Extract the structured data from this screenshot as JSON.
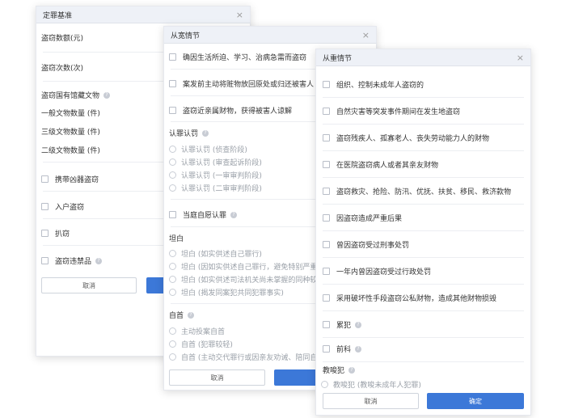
{
  "panel1": {
    "title": "定罪基准",
    "fields": [
      "盗窃数额(元)",
      "盗窃次数(次)"
    ],
    "cultural_relics": {
      "heading": "盗窃国有馆藏文物",
      "items": [
        "一般文物数量 (件)",
        "三级文物数量 (件)",
        "二级文物数量 (件)"
      ]
    },
    "checkboxes": [
      "携带凶器盗窃",
      "入户盗窃",
      "扒窃",
      "盗窃违禁品"
    ],
    "cancel": "取消"
  },
  "panel2": {
    "title": "从宽情节",
    "items": [
      "确因生活所迫、学习、治病急需而盗窃",
      "案发前主动将赃物放回原处或归还被害人",
      "盗窃近亲属财物，获得被害人谅解"
    ],
    "plea": {
      "heading": "认罪认罚",
      "options": [
        "认罪认罚 (侦查阶段)",
        "认罪认罚 (审查起诉阶段)",
        "认罪认罚 (一审审判阶段)",
        "认罪认罚 (二审审判阶段)"
      ]
    },
    "court_plea": "当庭自愿认罪",
    "confess": {
      "heading": "坦白",
      "options": [
        "坦白 (如实供述自己罪行)",
        "坦白 (因如实供述自己罪行，避免特别严重后",
        "坦白 (如实供述司法机关尚未掌握的同种较重",
        "坦白 (揭发同案犯共同犯罪事实)"
      ]
    },
    "surrender": {
      "heading": "自首",
      "options": [
        "主动投案自首",
        "自首 (犯罪较轻)",
        "自首 (主动交代罪行或因亲友劝诫、陪同自首"
      ]
    },
    "cancel": "取消"
  },
  "panel3": {
    "title": "从重情节",
    "items": [
      "组织、控制未成年人盗窃的",
      "自然灾害等突发事件期间在发生地盗窃",
      "盗窃残疾人、孤寡老人、丧失劳动能力人的财物",
      "在医院盗窃病人或者其亲友财物",
      "盗窃救灾、抢险、防汛、优抚、扶贫、移民、救济款物",
      "因盗窃造成严重后果",
      "曾因盗窃受过刑事处罚",
      "一年内曾因盗窃受过行政处罚",
      "采用破坏性手段盗窃公私财物，造成其他财物损毁",
      "累犯",
      "前科"
    ],
    "instigate": {
      "heading": "教唆犯",
      "option": "教唆犯 (教唆未成年人犯罪)"
    },
    "cancel": "取消",
    "confirm": "确定"
  }
}
